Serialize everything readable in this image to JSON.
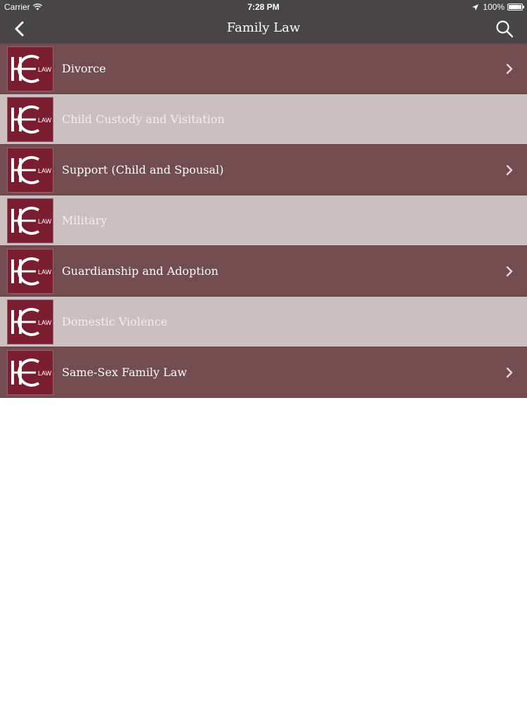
{
  "status_bar": {
    "carrier": "Carrier",
    "time": "7:28 PM",
    "battery": "100%"
  },
  "nav": {
    "title": "Family Law"
  },
  "logo": {
    "text": "LAW"
  },
  "items": [
    {
      "label": "Divorce",
      "has_chevron": true
    },
    {
      "label": "Child Custody and Visitation",
      "has_chevron": false
    },
    {
      "label": "Support (Child and Spousal)",
      "has_chevron": true
    },
    {
      "label": "Military",
      "has_chevron": false
    },
    {
      "label": "Guardianship and Adoption",
      "has_chevron": true
    },
    {
      "label": "Domestic Violence",
      "has_chevron": false
    },
    {
      "label": "Same-Sex Family Law",
      "has_chevron": true
    }
  ],
  "colors": {
    "nav_bg": "#474545",
    "row_dark": "#734c4f",
    "row_light": "#cbbfbf",
    "logo_bg": "#7a1d31"
  },
  "icons": [
    "wifi-icon",
    "location-icon",
    "battery-icon",
    "back-chevron-icon",
    "search-icon",
    "chevron-right-icon"
  ]
}
